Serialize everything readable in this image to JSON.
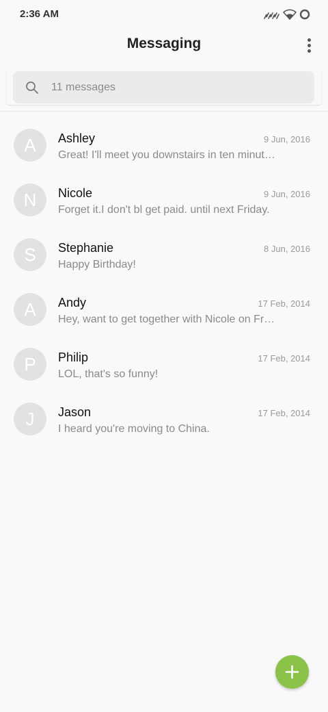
{
  "status_bar": {
    "time": "2:36 AM",
    "icons": [
      "signal-icon",
      "wifi-icon",
      "battery-circle-icon"
    ]
  },
  "header": {
    "title": "Messaging",
    "menu_icon": "more-vert-icon"
  },
  "search": {
    "placeholder": "11 messages",
    "icon": "search-icon"
  },
  "conversations": [
    {
      "initial": "A",
      "name": "Ashley",
      "date": "9 Jun, 2016",
      "preview": "Great! I'll meet you downstairs in ten minutes."
    },
    {
      "initial": "N",
      "name": "Nicole",
      "date": "9 Jun, 2016",
      "preview": "Forget it.I don't bl get paid. until next Friday."
    },
    {
      "initial": "S",
      "name": "Stephanie",
      "date": "8 Jun, 2016",
      "preview": "Happy Birthday!"
    },
    {
      "initial": "A",
      "name": "Andy",
      "date": "17 Feb, 2014",
      "preview": "Hey, want to get together with Nicole on Friday?"
    },
    {
      "initial": "P",
      "name": "Philip",
      "date": "17 Feb, 2014",
      "preview": "LOL, that's so funny!"
    },
    {
      "initial": "J",
      "name": "Jason",
      "date": "17 Feb, 2014",
      "preview": "I heard you're moving to China."
    }
  ],
  "fab": {
    "icon": "plus-icon"
  },
  "colors": {
    "background": "#f9f9f9",
    "avatar": "#e2e2e2",
    "accent": "#8bc34a"
  }
}
